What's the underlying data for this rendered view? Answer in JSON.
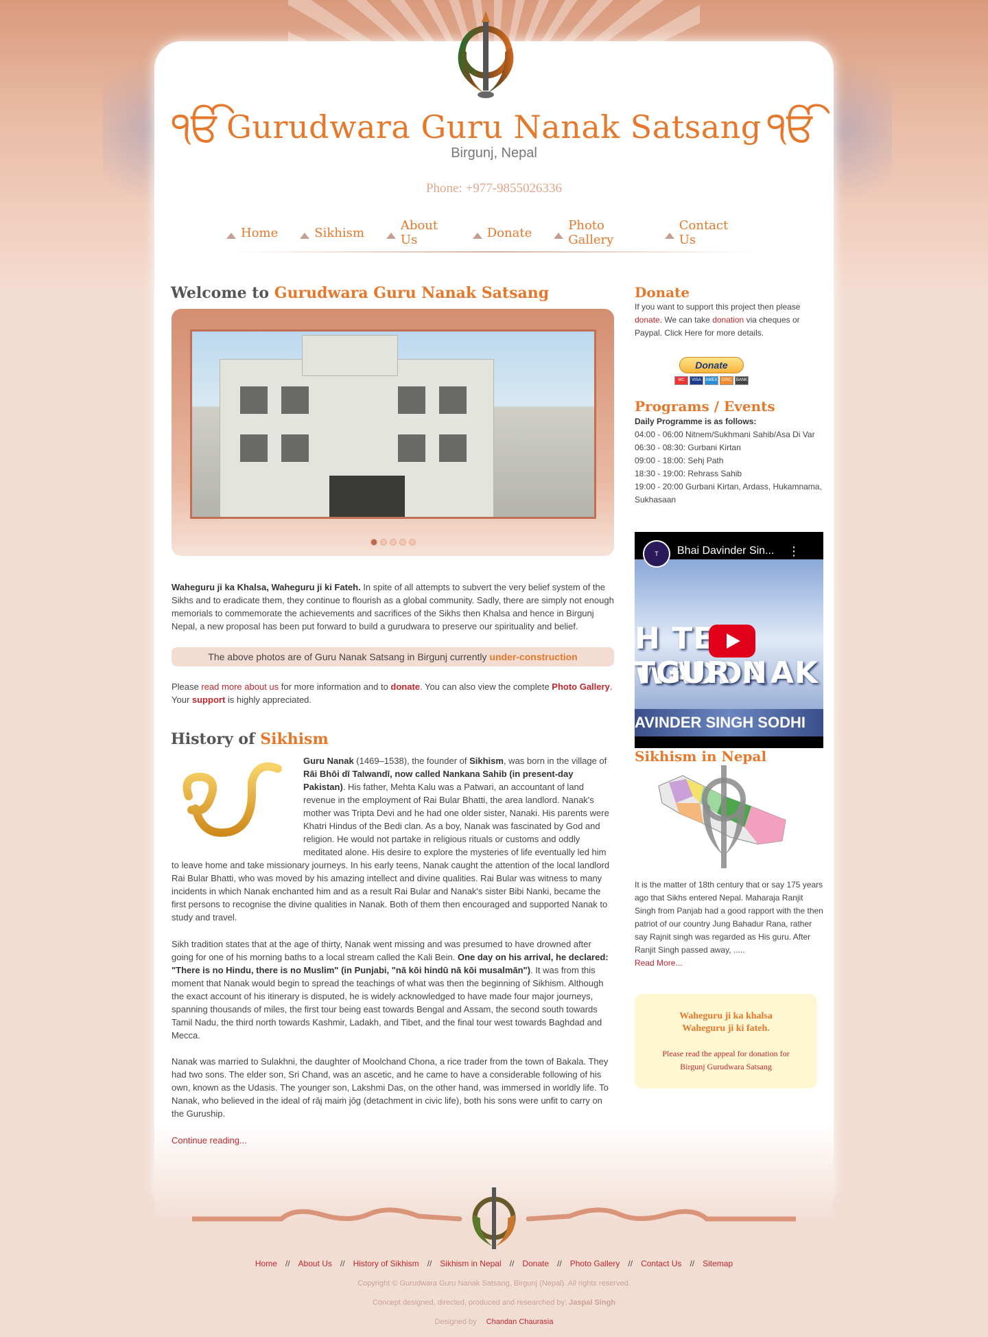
{
  "header": {
    "title": "Gurudwara Guru Nanak Satsang",
    "subtitle": "Birgunj, Nepal",
    "phone": "Phone: +977-9855026336",
    "ik_glyph": "ੴ"
  },
  "nav": {
    "items": [
      {
        "label": "Home"
      },
      {
        "label": "Sikhism"
      },
      {
        "label": "About Us"
      },
      {
        "label": "Donate"
      },
      {
        "label": "Photo Gallery"
      },
      {
        "label": "Contact Us"
      }
    ]
  },
  "welcome": {
    "prefix": "Welcome to",
    "accent": "Gurudwara Guru Nanak Satsang",
    "slider_dots": 5,
    "slider_active_dot": 1,
    "intro_bold": "Waheguru ji ka Khalsa, Waheguru ji ki Fateh.",
    "intro_text": " In spite of all attempts to subvert the very belief system of the Sikhs and to eradicate them, they continue to flourish as a global community. Sadly, there are simply not enough memorials to commemorate the achievements and sacrifices of the Sikhs then Khalsa and hence in Birgunj Nepal, a new proposal has been put forward to build a gurudwara to preserve our spirituality and belief.",
    "notice_text": "The above photos are of Guru Nanak Satsang in Birgunj currently ",
    "notice_highlight": "under-construction",
    "more_1": "Please ",
    "more_link1": "read more about us",
    "more_2": " for more information and to ",
    "more_link2": "donate",
    "more_3": ". You can also view the complete ",
    "more_link3": "Photo Gallery",
    "more_4": ". Your ",
    "more_link4": "support",
    "more_5": " is highly appreciated."
  },
  "history": {
    "prefix": "History of",
    "accent": "Sikhism",
    "p1_b1": "Guru Nanak",
    "p1_t1": " (1469–1538), the founder of ",
    "p1_b2": "Sikhism",
    "p1_t2": ", was born in the village of ",
    "p1_b3": "Rāi Bhōi dī Talwandī, now called Nankana Sahib (in present-day Pakistan)",
    "p1_t3": ". His father, Mehta Kalu was a Patwari, an accountant of land revenue in the employment of Rai Bular Bhatti, the area landlord. Nanak's mother was Tripta Devi and he had one older sister, Nanaki. His parents were Khatri Hindus of the Bedi clan. As a boy, Nanak was fascinated by God and religion. He would not partake in religious rituals or customs and oddly meditated alone. His desire to explore the mysteries of life eventually led him to leave home and take missionary journeys. In his early teens, Nanak caught the attention of the local landlord Rai Bular Bhatti, who was moved by his amazing intellect and divine qualities. Rai Bular was witness to many incidents in which Nanak enchanted him and as a result Rai Bular and Nanak's sister Bibi Nanki, became the first persons to recognise the divine qualities in Nanak. Both of them then encouraged and supported Nanak to study and travel.",
    "p2_t1": "Sikh tradition states that at the age of thirty, Nanak went missing and was presumed to have drowned after going for one of his morning baths to a local stream called the Kali Bein. ",
    "p2_b1": "One day on his arrival, he declared: \"There is no Hindu, there is no Muslim\" (in Punjabi, \"nā kōi hindū nā kōi musalmān\")",
    "p2_t2": ". It was from this moment that Nanak would begin to spread the teachings of what was then the beginning of Sikhism. Although the exact account of his itinerary is disputed, he is widely acknowledged to have made four major journeys, spanning thousands of miles, the first tour being east towards Bengal and Assam, the second south towards Tamil Nadu, the third north towards Kashmir, Ladakh, and Tibet, and the final tour west towards Baghdad and Mecca.",
    "p3": "Nanak was married to Sulakhni, the daughter of Moolchand Chona, a rice trader from the town of Bakala. They had two sons. The elder son, Sri Chand, was an ascetic, and he came to have a considerable following of his own, known as the Udasis. The younger son, Lakshmi Das, on the other hand, was immersed in worldly life. To Nanak, who believed in the ideal of rāj maiṁ jōg (detachment in civic life), both his sons were unfit to carry on the Guruship.",
    "continue": "Continue reading..."
  },
  "sidebar": {
    "donate_title": "Donate",
    "donate_t1": "If you want to support this project then please ",
    "donate_l1": "donate",
    "donate_t2": ". We can take ",
    "donate_l2": "donation",
    "donate_t3": " via cheques or Paypal. Click Here for more details.",
    "donate_button": "Donate",
    "cards": [
      "MC",
      "VISA",
      "AMEX",
      "DISC",
      "BANK"
    ],
    "programs_title": "Programs / Events",
    "programs_intro": "Daily Programme is as follows:",
    "programs": [
      "04:00 - 06:00 Nitnem/Sukhmani Sahib/Asa Di Var",
      "06:30 - 08:30: Gurbani Kirtan",
      "09:00 - 18:00: Sehj Path",
      "18:30 - 19:00: Rehrass Sahib",
      "19:00 - 20:00 Gurbani Kirtan, Ardass, Hukamnama, Sukhasaan"
    ],
    "video_title": "Bhai Davinder Sin...",
    "video_line1": "H TE WADDA",
    "video_line2": "TGUR N",
    "video_line2b": "AK",
    "video_name": "AVINDER SINGH SODHI",
    "video_menu": "⋮",
    "video_logo": "T",
    "nepal_title": "Sikhism in Nepal",
    "nepal_text": "It is the matter of 18th century that or say 175 years ago that Sikhs entered Nepal. Maharaja Ranjit Singh from Panjab had a good rapport with the then patriot of our country Jung Bahadur Rana, rather say Rajnit singh was regarded as His guru. After Ranjit Singh passed away, .....",
    "nepal_more": "Read More...",
    "appeal_1": "Waheguru ji ka khalsa",
    "appeal_2": "Waheguru ji ki fateh.",
    "appeal_3": "Please read the appeal for donation for",
    "appeal_4": "Birgunj Gurudwara Satsang"
  },
  "footer": {
    "links": [
      "Home",
      "About Us",
      "History of Sikhism",
      "Sikhism in Nepal",
      "Donate",
      "Photo Gallery",
      "Contact Us",
      "Sitemap"
    ],
    "separator": "//",
    "copyright": "Copyright © Gurudwara Guru Nanak Satsang, Birgunj (Nepal). All rights reserved.",
    "concept": "Concept designed, directed, produced and researched by: ",
    "concept_name": "Jaspal Singh",
    "designed_by": "Designed by",
    "designer": "Chandan Chaurasia"
  },
  "colors": {
    "accent": "#e5782a",
    "link": "#c0272d",
    "background": "#f2ddd3"
  }
}
